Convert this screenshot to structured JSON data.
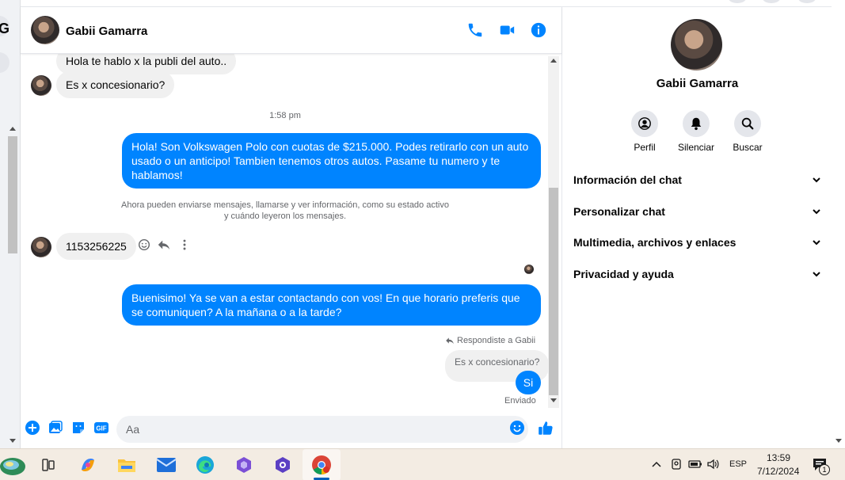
{
  "header": {
    "contact_name": "Gabii Gamarra"
  },
  "messages": {
    "partial_top": "Hola te hablo x la publi del auto..",
    "incoming_1": "Es x concesionario?",
    "time_label": "1:58 pm",
    "outgoing_1": "Hola! Son Volkswagen Polo con cuotas de $215.000. Podes retirarlo con un auto usado o un anticipo! Tambien tenemos otros autos. Pasame tu numero y te hablamos!",
    "notice_line1": "Ahora pueden enviarse mensajes, llamarse y ver información, como su estado activo",
    "notice_line2": "y cuándo leyeron los mensajes.",
    "incoming_2": "1153256225",
    "outgoing_2": "Buenisimo! Ya se van a estar contactando con vos! En que horario preferis que se comuniquen? A la mañana o a la tarde?",
    "reply_label": "Respondiste a Gabii",
    "quoted_text": "Es x concesionario?",
    "outgoing_3": "Si",
    "status": "Enviado"
  },
  "composer": {
    "placeholder": "Aa"
  },
  "profile": {
    "name": "Gabii Gamarra",
    "actions": [
      {
        "label": "Perfil",
        "icon": "profile-icon"
      },
      {
        "label": "Silenciar",
        "icon": "bell-icon"
      },
      {
        "label": "Buscar",
        "icon": "search-icon"
      }
    ],
    "sections": [
      "Información del chat",
      "Personalizar chat",
      "Multimedia, archivos y enlaces",
      "Privacidad y ayuda"
    ]
  },
  "left": {
    "letter": "G"
  },
  "taskbar": {
    "language": "ESP",
    "time": "13:59",
    "date": "7/12/2024",
    "notification_count": "1"
  },
  "colors": {
    "accent": "#0084ff",
    "bubble_in": "#f0f0f0"
  }
}
